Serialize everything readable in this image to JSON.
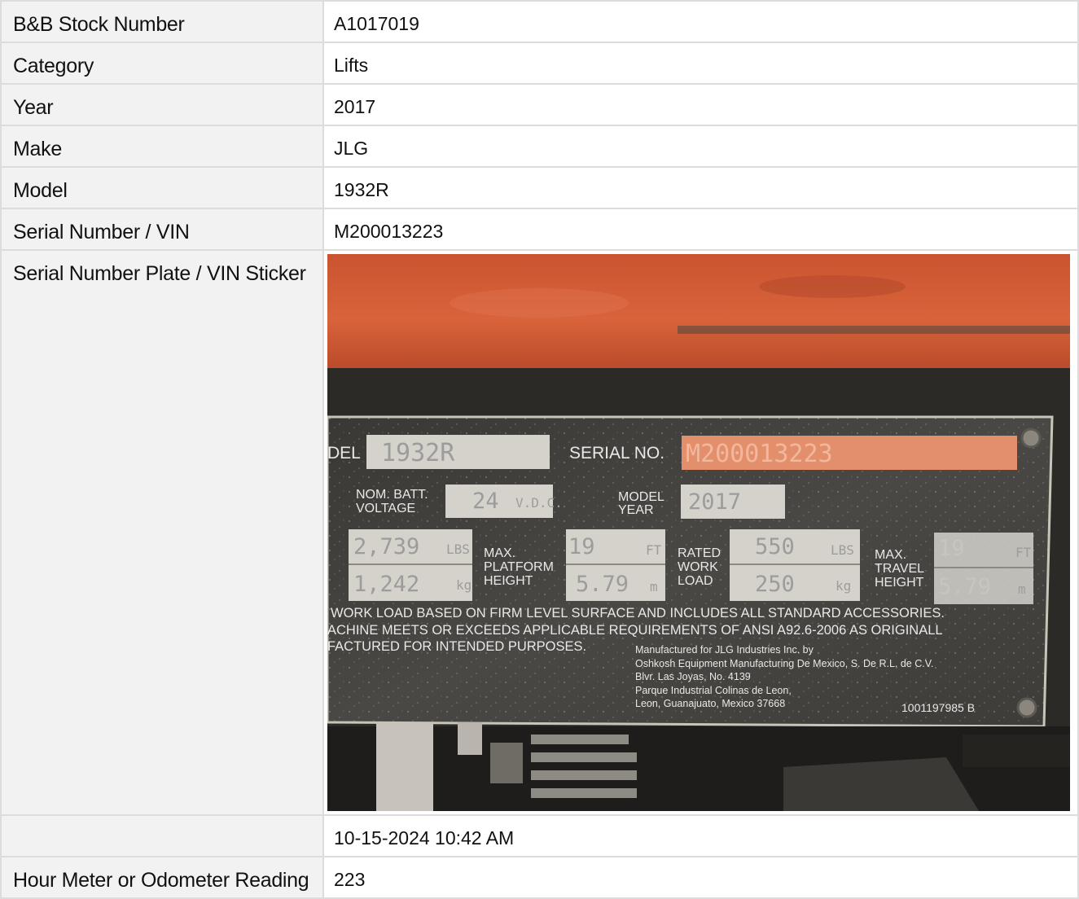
{
  "rows": [
    {
      "label": "B&B Stock Number",
      "value": "A1017019"
    },
    {
      "label": "Category",
      "value": "Lifts"
    },
    {
      "label": "Year",
      "value": "2017"
    },
    {
      "label": "Make",
      "value": "JLG"
    },
    {
      "label": "Model",
      "value": "1932R"
    },
    {
      "label": "Serial Number / VIN",
      "value": "M200013223"
    }
  ],
  "photo_row": {
    "label": "Serial Number Plate / VIN Sticker"
  },
  "timestamp_row": {
    "label": "",
    "value": "10-15-2024 10:42 AM"
  },
  "last_row": {
    "label": "Hour Meter or Odometer Reading",
    "value": "223"
  },
  "plate": {
    "model_label": "DEL",
    "model_value": "1932R",
    "serial_label": "SERIAL NO.",
    "serial_value": "M200013223",
    "batt_label_1": "NOM. BATT.",
    "batt_label_2": "VOLTAGE",
    "batt_value": "24",
    "batt_unit": "V.D.C.",
    "year_label_1": "MODEL",
    "year_label_2": "YEAR",
    "year_value": "2017",
    "weight_lbs": "2,739",
    "weight_lbs_unit": "LBS",
    "weight_kg": "1,242",
    "weight_kg_unit": "kg",
    "platform_label_1": "MAX.",
    "platform_label_2": "PLATFORM",
    "platform_label_3": "HEIGHT",
    "platform_ft": "19",
    "platform_ft_unit": "FT",
    "platform_m": "5.79",
    "platform_m_unit": "m",
    "load_label_1": "RATED",
    "load_label_2": "WORK",
    "load_label_3": "LOAD",
    "load_lbs": "550",
    "load_lbs_unit": "LBS",
    "load_kg": "250",
    "load_kg_unit": "kg",
    "travel_label_1": "MAX.",
    "travel_label_2": "TRAVEL",
    "travel_label_3": "HEIGHT",
    "travel_ft": "19",
    "travel_ft_unit": "FT",
    "travel_m": "5.79",
    "travel_m_unit": "m",
    "notice_1": "WORK LOAD BASED ON FIRM LEVEL SURFACE AND INCLUDES ALL STANDARD ACCESSORIES.",
    "notice_2": "ACHINE MEETS OR EXCEEDS APPLICABLE REQUIREMENTS OF ANSI A92.6-2006 AS ORIGINALL",
    "notice_3": "FACTURED FOR INTENDED PURPOSES.",
    "mfr_1": "Manufactured for JLG Industries Inc. by",
    "mfr_2": "Oshkosh Equipment Manufacturing De Mexico, S. De R.L. de C.V.",
    "mfr_3": "Blvr. Las Joyas, No. 4139",
    "mfr_4": "Parque Industrial Colinas de Leon,",
    "mfr_5": "Leon, Guanajuato, Mexico 37668",
    "part_no": "1001197985 B"
  }
}
